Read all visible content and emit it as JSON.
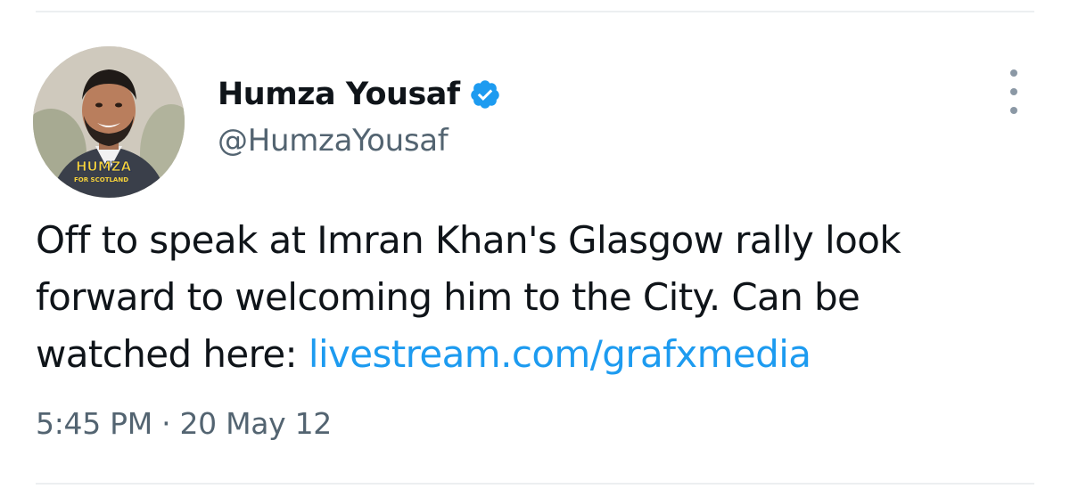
{
  "author": {
    "display_name": "Humza Yousaf",
    "handle": "@HumzaYousaf",
    "avatar_caption_line1": "HUMZA",
    "avatar_caption_line2": "FOR SCOTLAND",
    "verified_icon": "verified-badge-icon"
  },
  "menu": {
    "icon": "more-options-icon"
  },
  "tweet": {
    "text_line1": "Off to speak at Imran Khan's Glasgow rally look",
    "text_line2": "forward to welcoming him to the City. Can be",
    "text_line3_prefix": "watched here: ",
    "link": "livestream.com/grafxmedia",
    "time": "5:45 PM",
    "separator": "·",
    "date": "20 May 12"
  },
  "colors": {
    "link": "#1d9bf0",
    "verified": "#1d9bf0",
    "text": "#0f1419",
    "muted": "#536471"
  }
}
